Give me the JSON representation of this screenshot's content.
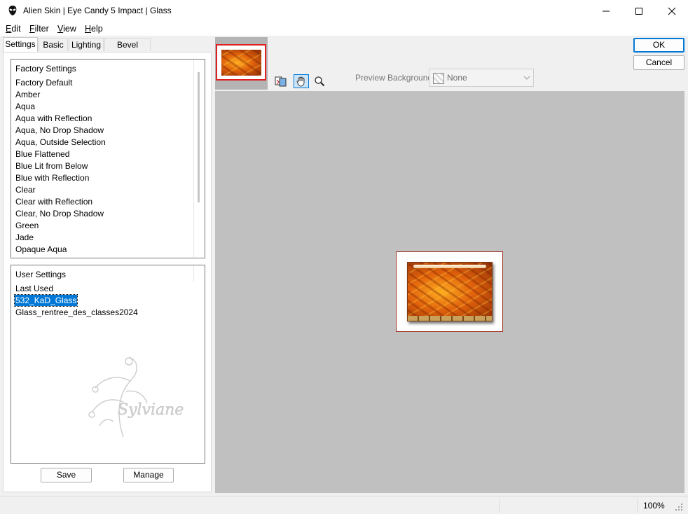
{
  "window": {
    "title": "Alien Skin | Eye Candy 5 Impact | Glass"
  },
  "menu": {
    "items": [
      {
        "label": "Edit"
      },
      {
        "label": "Filter"
      },
      {
        "label": "View"
      },
      {
        "label": "Help"
      }
    ]
  },
  "tabs": [
    {
      "label": "Settings",
      "active": true
    },
    {
      "label": "Basic",
      "active": false
    },
    {
      "label": "Lighting",
      "active": false
    },
    {
      "label": "Bevel Profile",
      "active": false
    }
  ],
  "factory_settings": {
    "header": "Factory Settings",
    "items": [
      "Factory Default",
      "Amber",
      "Aqua",
      "Aqua with Reflection",
      "Aqua, No Drop Shadow",
      "Aqua, Outside Selection",
      "Blue Flattened",
      "Blue Lit from Below",
      "Blue with Reflection",
      "Clear",
      "Clear with Reflection",
      "Clear, No Drop Shadow",
      "Green",
      "Jade",
      "Opaque Aqua"
    ]
  },
  "user_settings": {
    "header": "User Settings",
    "items": [
      {
        "label": "Last Used",
        "selected": false
      },
      {
        "label": "532_KaD_Glass",
        "selected": true
      },
      {
        "label": "Glass_rentree_des_classes2024",
        "selected": false
      }
    ],
    "watermark_text": "Sylviane"
  },
  "buttons": {
    "save": "Save",
    "manage": "Manage",
    "ok": "OK",
    "cancel": "Cancel"
  },
  "preview_toolbar": {
    "background_label": "Preview Background:",
    "background_value": "None"
  },
  "status": {
    "zoom": "100%"
  },
  "colors": {
    "selection": "#0078d7",
    "preview_bg": "#c0c0c0",
    "thumb_border": "#e02020"
  }
}
